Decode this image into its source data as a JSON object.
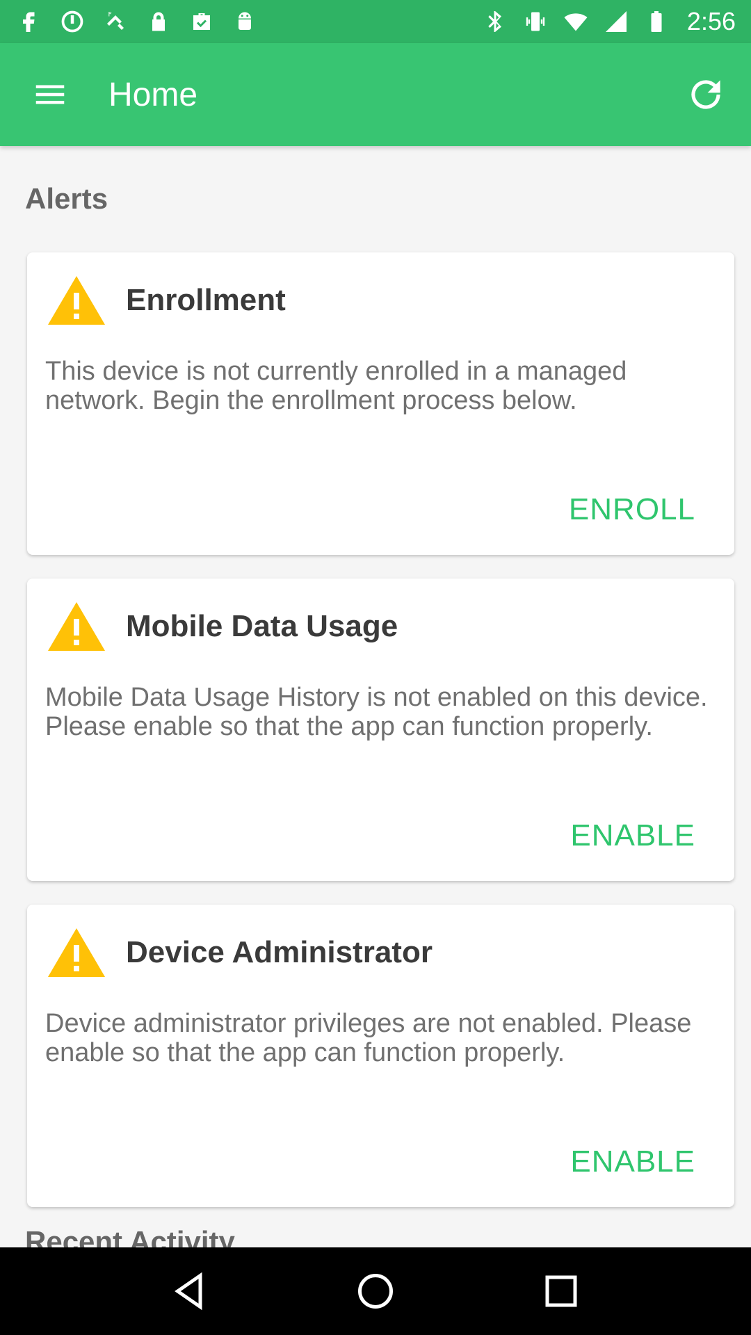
{
  "status_bar": {
    "time": "2:56",
    "left_icons": [
      "facebook-icon",
      "sync-icon",
      "fake-gps-icon",
      "lock-icon",
      "briefcase-check-icon",
      "android-icon"
    ],
    "right_icons": [
      "bluetooth-icon",
      "vibrate-icon",
      "wifi-icon",
      "signal-icon",
      "battery-icon"
    ]
  },
  "app_bar": {
    "title": "Home",
    "menu_icon": "menu-icon",
    "refresh_icon": "refresh-icon",
    "background": "#38c572"
  },
  "alerts": {
    "section_title": "Alerts",
    "cards": [
      {
        "title": "Enrollment",
        "body": "This device is not currently enrolled in a managed network. Begin the enrollment process below.",
        "action": "ENROLL",
        "icon": "warning-icon"
      },
      {
        "title": "Mobile Data Usage",
        "body": "Mobile Data Usage History is not enabled on this device. Please enable so that the app can function properly.",
        "action": "ENABLE",
        "icon": "warning-icon"
      },
      {
        "title": "Device Administrator",
        "body": "Device administrator privileges are not enabled. Please enable so that the app can function properly.",
        "action": "ENABLE",
        "icon": "warning-icon"
      }
    ]
  },
  "next_section_title": "Recent Activity",
  "nav_bar": {
    "buttons": [
      "back-icon",
      "home-icon",
      "recents-icon"
    ]
  },
  "colors": {
    "status_bar": "#2fb364",
    "accent": "#2fc56d",
    "warning": "#ffc107"
  }
}
